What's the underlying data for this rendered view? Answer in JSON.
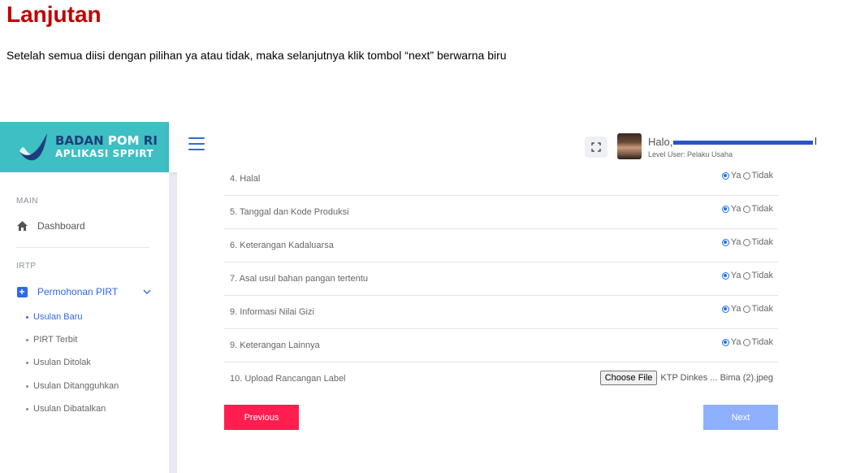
{
  "doc": {
    "title": "Lanjutan",
    "instruction": "Setelah semua diisi dengan pilihan ya atau tidak, maka selanjutnya klik tombol “next” berwarna biru"
  },
  "brand": {
    "line1_a": "BADAN ",
    "line1_b": "POM",
    "line1_c": " RI",
    "line2": "APLIKASI SPPIRT",
    "color": "#3dbfc4"
  },
  "sidebar": {
    "section_main": "MAIN",
    "dashboard": "Dashboard",
    "section_irtp": "IRTP",
    "permohonan": "Permohonan PIRT",
    "sub_items": [
      "Usulan Baru",
      "PIRT Terbit",
      "Usulan Ditolak",
      "Usulan Ditangguhkan",
      "Usulan Dibatalkan"
    ]
  },
  "topbar": {
    "greeting": "Halo,",
    "name_suffix": "K",
    "level": "Level User: Pelaku Usaha"
  },
  "form": {
    "questions": [
      {
        "label": "4. Halal",
        "yes": "Ya",
        "no": "Tidak",
        "selected": "Ya"
      },
      {
        "label": "5. Tanggal dan Kode Produksi",
        "yes": "Ya",
        "no": "Tidak",
        "selected": "Ya"
      },
      {
        "label": "6. Keterangan Kadaluarsa",
        "yes": "Ya",
        "no": "Tidak",
        "selected": "Ya"
      },
      {
        "label": "7. Asal usul bahan pangan tertentu",
        "yes": "Ya",
        "no": "Tidak",
        "selected": "Ya"
      },
      {
        "label": "9. Informasi Nilai Gizi",
        "yes": "Ya",
        "no": "Tidak",
        "selected": "Ya"
      },
      {
        "label": "9. Keterangan Lainnya",
        "yes": "Ya",
        "no": "Tidak",
        "selected": "Ya"
      }
    ],
    "upload_label": "10. Upload Rancangan Label",
    "choose_file": "Choose File",
    "file_name": "KTP Dinkes ... Bima (2).jpeg",
    "previous": "Previous",
    "next": "Next",
    "accent": "#3068e8",
    "prev_color": "#ff1e4f",
    "next_color": "#8fb0ff"
  }
}
